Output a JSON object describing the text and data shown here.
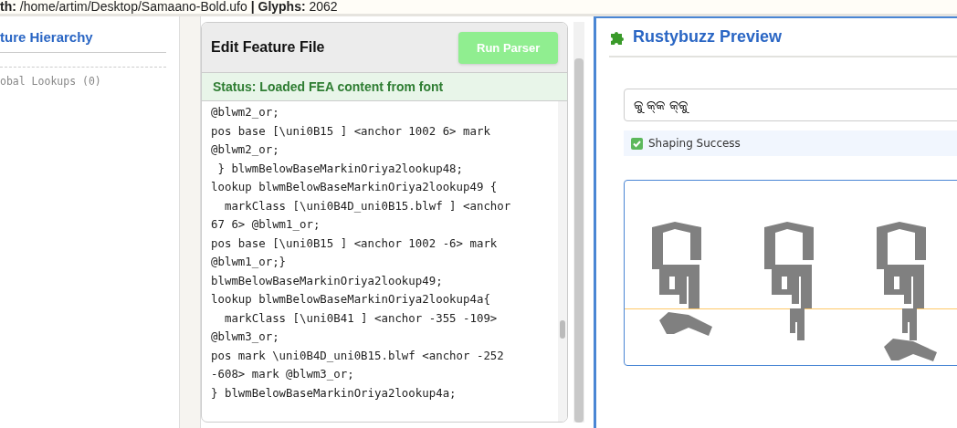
{
  "header": {
    "info": "**th:** /home/artim/Desktop/Samaano-Bold.ufo **| Glyphs:** 2062"
  },
  "sidebar": {
    "title": "ture Hierarchy",
    "items": [
      "obal Lookups (0)"
    ]
  },
  "editor": {
    "title": "Edit Feature File",
    "run_button": {
      "label": "Run Parser",
      "disabled": true
    },
    "status": "Status: Loaded FEA content from font",
    "lines": [
      "@blwm2_or;",
      "pos base [\\uni0B15 ] <anchor 1002 6> mark",
      "@blwm2_or;",
      " } blwmBelowBaseMarkinOriya2lookup48;",
      "lookup blwmBelowBaseMarkinOriya2lookup49 {",
      "  markClass [\\uni0B4D_uni0B15.blwf ] <anchor",
      "67 6> @blwm1_or;",
      "pos base [\\uni0B15 ] <anchor 1002 -6> mark",
      "@blwm1_or;}",
      "blwmBelowBaseMarkinOriya2lookup49;",
      "lookup blwmBelowBaseMarkinOriya2lookup4a{",
      "  markClass [\\uni0B41 ] <anchor -355 -109>",
      "@blwm3_or;",
      "pos mark \\uni0B4D_uni0B15.blwf <anchor -252",
      "-608> mark @blwm3_or;",
      "} blwmBelowBaseMarkinOriya2lookup4a;"
    ]
  },
  "preview": {
    "title": "Rustybuzz Preview",
    "input_value": "କୁ କ୍କ କ୍କୁ",
    "result": "Shaping Success"
  }
}
